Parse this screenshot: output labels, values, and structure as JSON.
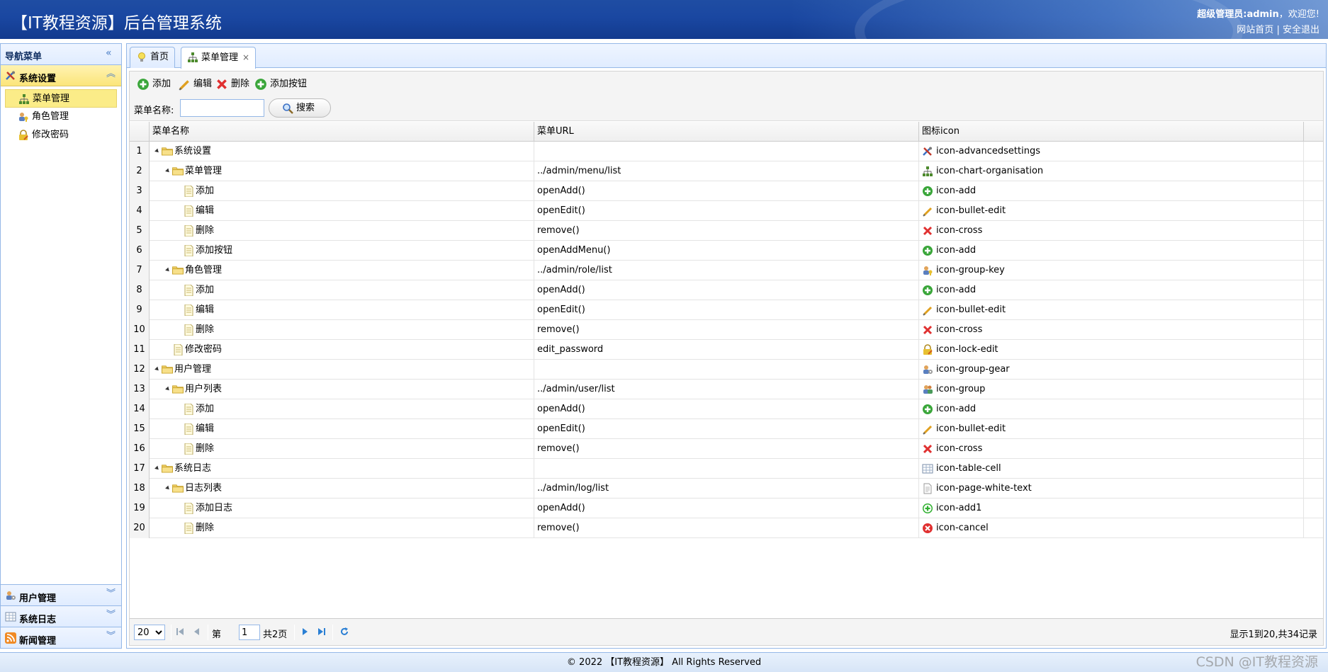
{
  "header": {
    "title": "【IT教程资源】后台管理系统",
    "user_prefix": "超级管理员:",
    "user_name": "admin",
    "welcome": "，欢迎您!",
    "link_home": "网站首页",
    "link_sep": "|",
    "link_logout": "安全退出"
  },
  "nav": {
    "title": "导航菜单",
    "active_group": {
      "label": "系统设置",
      "icon": "advanced-settings-icon"
    },
    "items": [
      {
        "label": "菜单管理",
        "icon": "chart-organisation-icon",
        "active": true
      },
      {
        "label": "角色管理",
        "icon": "group-key-icon",
        "active": false
      },
      {
        "label": "修改密码",
        "icon": "lock-edit-icon",
        "active": false
      }
    ],
    "groups": [
      {
        "label": "用户管理",
        "icon": "group-gear-icon"
      },
      {
        "label": "系统日志",
        "icon": "table-cell-icon"
      },
      {
        "label": "新闻管理",
        "icon": "rss-icon"
      }
    ]
  },
  "tabs": [
    {
      "label": "首页",
      "icon": "lightbulb-icon",
      "selected": false
    },
    {
      "label": "菜单管理",
      "icon": "chart-organisation-icon",
      "selected": true,
      "close": "×"
    }
  ],
  "toolbar": {
    "add": "添加",
    "edit": "编辑",
    "delete": "删除",
    "add_button": "添加按钮"
  },
  "search": {
    "label": "菜单名称:",
    "value": "",
    "button": "搜索"
  },
  "grid": {
    "columns": [
      "菜单名称",
      "菜单URL",
      "图标icon"
    ],
    "rows": [
      {
        "num": "1",
        "name": "系统设置",
        "level": 0,
        "type": "folder",
        "url": "",
        "icon": "icon-advancedsettings"
      },
      {
        "num": "2",
        "name": "菜单管理",
        "level": 1,
        "type": "folder",
        "url": "../admin/menu/list",
        "icon": "icon-chart-organisation"
      },
      {
        "num": "3",
        "name": "添加",
        "level": 2,
        "type": "file",
        "url": "openAdd()",
        "icon": "icon-add"
      },
      {
        "num": "4",
        "name": "编辑",
        "level": 2,
        "type": "file",
        "url": "openEdit()",
        "icon": "icon-bullet-edit"
      },
      {
        "num": "5",
        "name": "删除",
        "level": 2,
        "type": "file",
        "url": "remove()",
        "icon": "icon-cross"
      },
      {
        "num": "6",
        "name": "添加按钮",
        "level": 2,
        "type": "file",
        "url": "openAddMenu()",
        "icon": "icon-add"
      },
      {
        "num": "7",
        "name": "角色管理",
        "level": 1,
        "type": "folder",
        "url": "../admin/role/list",
        "icon": "icon-group-key"
      },
      {
        "num": "8",
        "name": "添加",
        "level": 2,
        "type": "file",
        "url": "openAdd()",
        "icon": "icon-add"
      },
      {
        "num": "9",
        "name": "编辑",
        "level": 2,
        "type": "file",
        "url": "openEdit()",
        "icon": "icon-bullet-edit"
      },
      {
        "num": "10",
        "name": "删除",
        "level": 2,
        "type": "file",
        "url": "remove()",
        "icon": "icon-cross"
      },
      {
        "num": "11",
        "name": "修改密码",
        "level": 1,
        "type": "file",
        "url": "edit_password",
        "icon": "icon-lock-edit"
      },
      {
        "num": "12",
        "name": "用户管理",
        "level": 0,
        "type": "folder",
        "url": "",
        "icon": "icon-group-gear"
      },
      {
        "num": "13",
        "name": "用户列表",
        "level": 1,
        "type": "folder",
        "url": "../admin/user/list",
        "icon": "icon-group"
      },
      {
        "num": "14",
        "name": "添加",
        "level": 2,
        "type": "file",
        "url": "openAdd()",
        "icon": "icon-add"
      },
      {
        "num": "15",
        "name": "编辑",
        "level": 2,
        "type": "file",
        "url": "openEdit()",
        "icon": "icon-bullet-edit"
      },
      {
        "num": "16",
        "name": "删除",
        "level": 2,
        "type": "file",
        "url": "remove()",
        "icon": "icon-cross"
      },
      {
        "num": "17",
        "name": "系统日志",
        "level": 0,
        "type": "folder",
        "url": "",
        "icon": "icon-table-cell"
      },
      {
        "num": "18",
        "name": "日志列表",
        "level": 1,
        "type": "folder",
        "url": "../admin/log/list",
        "icon": "icon-page-white-text"
      },
      {
        "num": "19",
        "name": "添加日志",
        "level": 2,
        "type": "file",
        "url": "openAdd()",
        "icon": "icon-add1"
      },
      {
        "num": "20",
        "name": "删除",
        "level": 2,
        "type": "file",
        "url": "remove()",
        "icon": "icon-cancel"
      }
    ]
  },
  "pager": {
    "page_size": "20",
    "page_prefix": "第",
    "page_value": "1",
    "page_total": "共2页",
    "info": "显示1到20,共34记录"
  },
  "footer": {
    "text": "© 2022 【IT教程资源】 All Rights Reserved"
  },
  "watermark": "CSDN @IT教程资源",
  "colors": {
    "header_blue": "#1a47a1",
    "border_blue": "#95b8e7",
    "active_yellow": "#fbec88"
  }
}
